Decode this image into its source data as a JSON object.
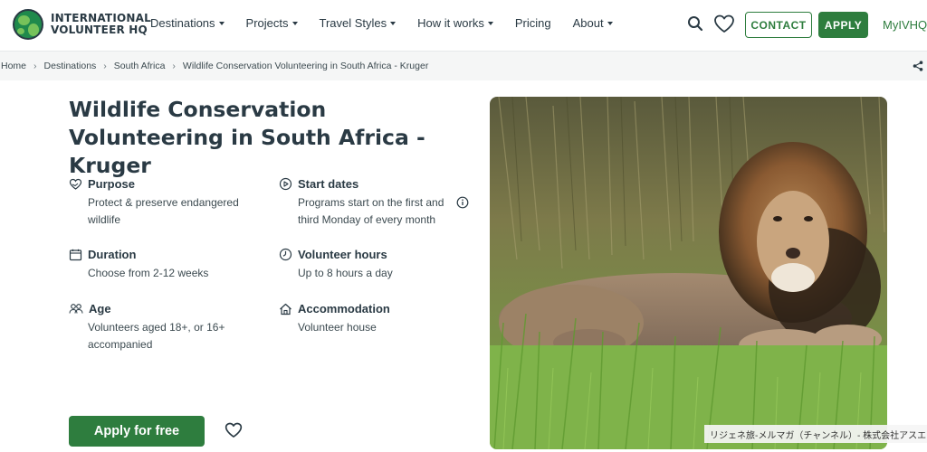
{
  "header": {
    "logo_line1": "INTERNATIONAL",
    "logo_line2": "VOLUNTEER HQ",
    "nav": [
      {
        "label": "Destinations",
        "dropdown": true
      },
      {
        "label": "Projects",
        "dropdown": true
      },
      {
        "label": "Travel Styles",
        "dropdown": true
      },
      {
        "label": "How it works",
        "dropdown": true
      },
      {
        "label": "Pricing",
        "dropdown": false
      },
      {
        "label": "About",
        "dropdown": true
      }
    ],
    "contact_label": "CONTACT",
    "apply_label": "APPLY",
    "account_label": "MyIVHQ",
    "icons": [
      "search-icon",
      "heart-icon"
    ]
  },
  "breadcrumb": {
    "items": [
      "Home",
      "Destinations",
      "South Africa",
      "Wildlife Conservation Volunteering in South Africa - Kruger"
    ],
    "separator": "›"
  },
  "main": {
    "title": "Wildlife Conservation Volunteering in South Africa - Kruger",
    "facts": {
      "purpose": {
        "label": "Purpose",
        "value": "Protect & preserve endangered wildlife"
      },
      "start_dates": {
        "label": "Start dates",
        "value": "Programs start on the first and third Monday of every month"
      },
      "duration": {
        "label": "Duration",
        "value": "Choose from 2-12 weeks"
      },
      "hours": {
        "label": "Volunteer hours",
        "value": "Up to 8 hours a day"
      },
      "age": {
        "label": "Age",
        "value": "Volunteers aged 18+, or 16+ accompanied"
      },
      "accommodation": {
        "label": "Accommodation",
        "value": "Volunteer house"
      }
    },
    "apply_free_label": "Apply for free"
  },
  "overlay_caption": "リジェネ旅-メルマガ（チャンネル）- 株式会社アスエ",
  "colors": {
    "brand_green": "#2e7d3e",
    "text_dark": "#2a3a44",
    "breadcrumb_bg": "#f5f6f6"
  }
}
